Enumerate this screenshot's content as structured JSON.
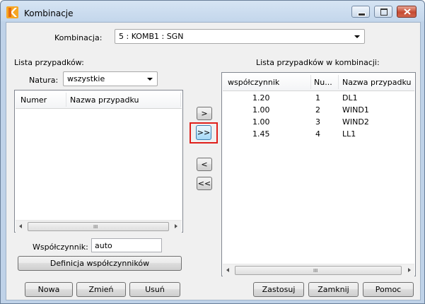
{
  "window": {
    "title": "Kombinacje"
  },
  "kombinacja": {
    "label": "Kombinacja:",
    "value": "5 : KOMB1 : SGN"
  },
  "left_panel": {
    "title": "Lista przypadków:",
    "natura_label": "Natura:",
    "natura_value": "wszystkie",
    "columns": [
      "Numer",
      "Nazwa przypadku"
    ],
    "rows": [],
    "wspolczynnik_label": "Współczynnik:",
    "wspolczynnik_value": "auto",
    "definicja_button": "Definicja współczynników"
  },
  "transfer_buttons": {
    "add_one": ">",
    "add_all": ">>",
    "remove_one": "<",
    "remove_all": "<<"
  },
  "right_panel": {
    "title": "Lista przypadków w kombinacji:",
    "columns": [
      "współczynnik",
      "Nu...",
      "Nazwa przypadku"
    ],
    "rows": [
      {
        "coef": "1.20",
        "num": "1",
        "name": "DL1"
      },
      {
        "coef": "1.00",
        "num": "2",
        "name": "WIND1"
      },
      {
        "coef": "1.00",
        "num": "3",
        "name": "WIND2"
      },
      {
        "coef": "1.45",
        "num": "4",
        "name": "LL1"
      }
    ]
  },
  "bottom_buttons": {
    "nowa": "Nowa",
    "zmien": "Zmień",
    "usun": "Usuń",
    "zastosuj": "Zastosuj",
    "zamknij": "Zamknij",
    "pomoc": "Pomoc"
  },
  "scrollbar_grip": "III",
  "colors": {
    "highlight": "#e0201b",
    "title_bar": "#c4d7ec",
    "app_icon": "#f08a1c"
  }
}
